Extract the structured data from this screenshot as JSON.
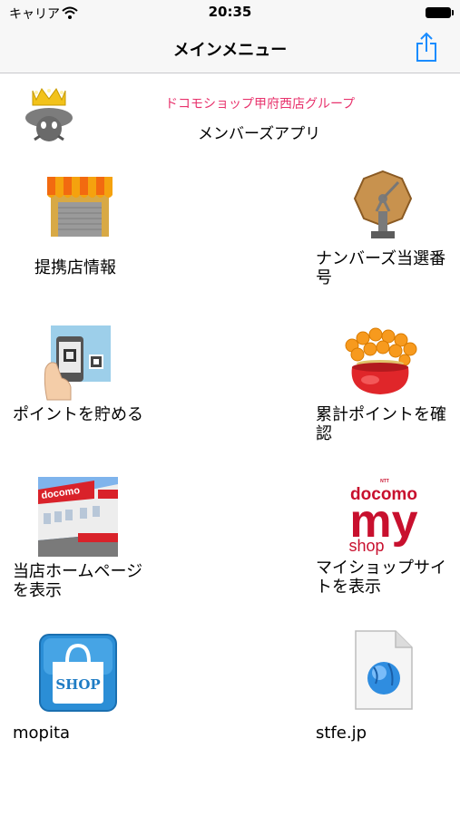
{
  "status_bar": {
    "carrier": "キャリア",
    "time": "20:35"
  },
  "nav": {
    "title": "メインメニュー",
    "share_icon": "share-icon"
  },
  "header": {
    "shop_name": "ドコモショップ甲府西店グループ",
    "app_name": "メンバーズアプリ"
  },
  "menu": [
    {
      "label": "提携店情報",
      "icon": "storefront-icon"
    },
    {
      "label": "ナンバーズ当選番号",
      "icon": "lottery-wheel-icon"
    },
    {
      "label": "ポイントを貯める",
      "icon": "phone-qr-scan-icon"
    },
    {
      "label": "累計ポイントを確認",
      "icon": "coin-purse-icon"
    },
    {
      "label": "当店ホームページを表示",
      "icon": "docomo-store-photo-icon"
    },
    {
      "label": "マイショップサイトを表示",
      "icon": "docomo-myshop-logo-icon",
      "logo_text": [
        "docomo",
        "my",
        "shop"
      ]
    },
    {
      "label": "mopita",
      "icon": "shop-bag-icon",
      "logo_text": [
        "SHOP"
      ]
    },
    {
      "label": "stfe.jp",
      "icon": "web-document-icon"
    }
  ],
  "colors": {
    "shop_name": "#e8336d",
    "navbar": "#f7f7f7",
    "accent": "#1a8cff",
    "docomo_red": "#c8102e"
  }
}
